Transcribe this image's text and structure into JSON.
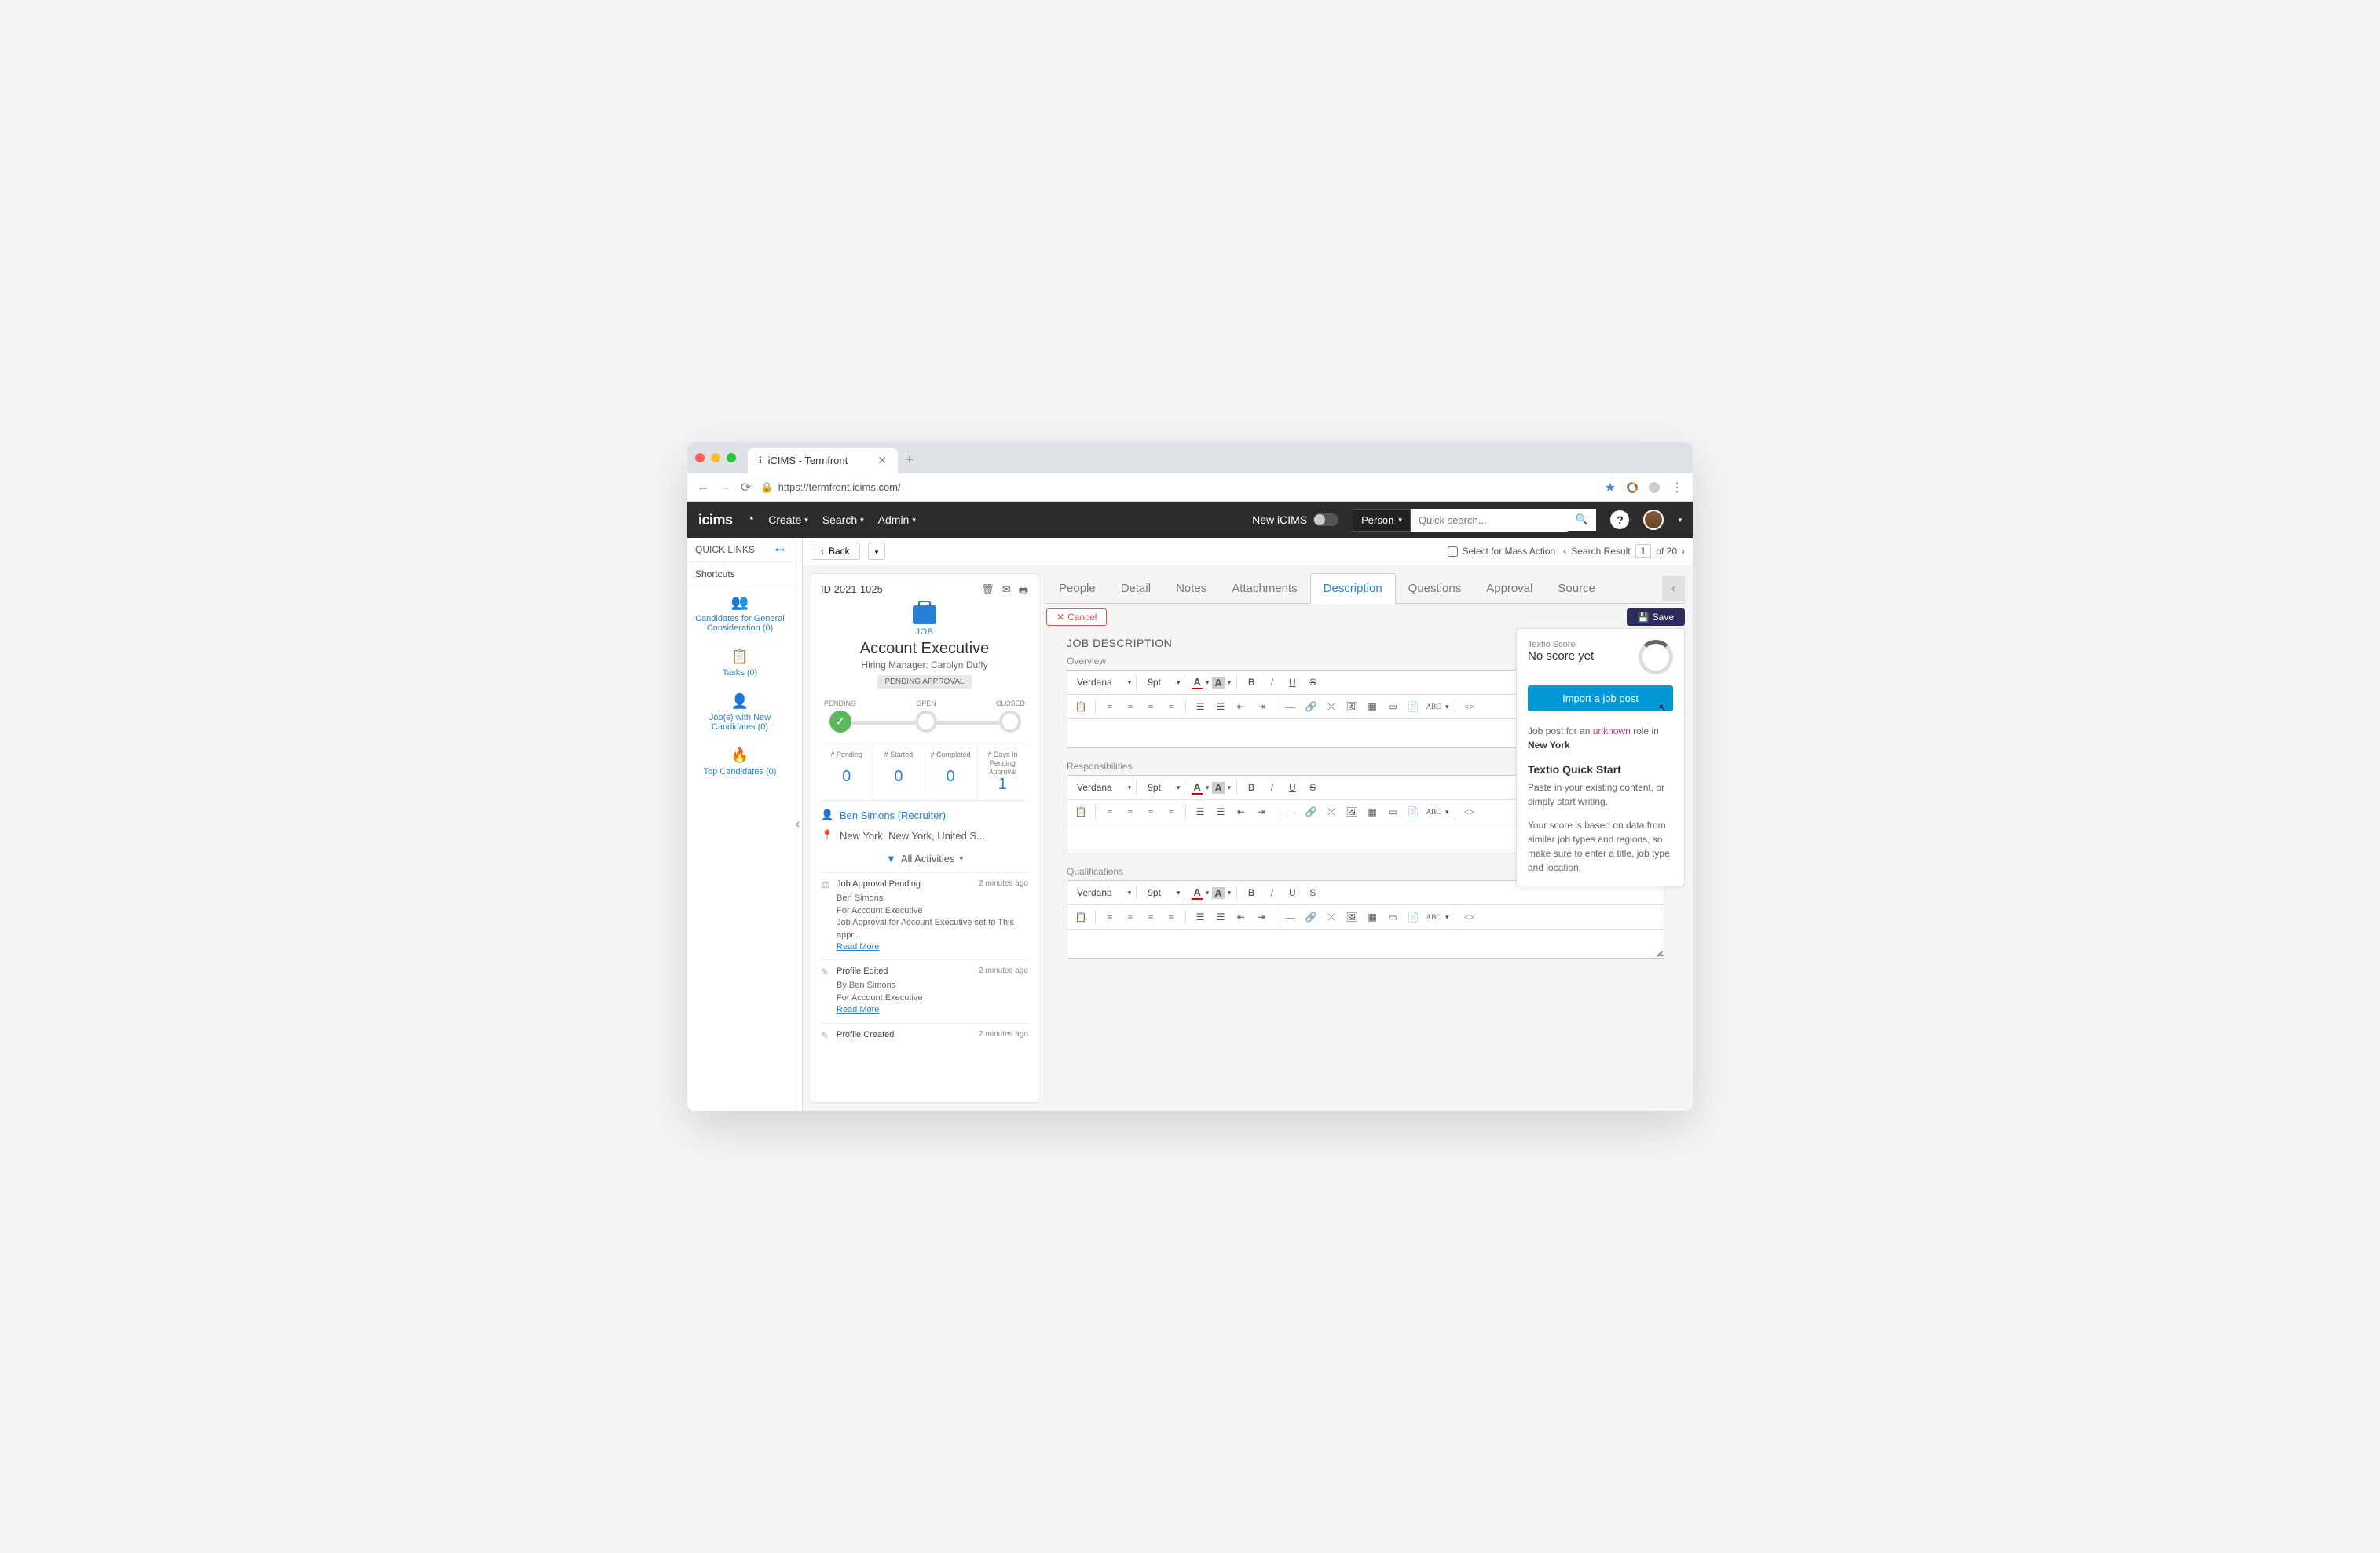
{
  "browser": {
    "tab_title": "iCIMS - Termfront",
    "url": "https://termfront.icims.com/"
  },
  "nav": {
    "logo": "icims",
    "items": [
      "Create",
      "Search",
      "Admin"
    ],
    "toggle_label": "New iCIMS",
    "person_label": "Person",
    "search_placeholder": "Quick search..."
  },
  "action_bar": {
    "back": "Back",
    "mass_action": "Select for Mass Action",
    "search_result_label": "Search Result",
    "search_result_current": "1",
    "search_result_total": "of 20"
  },
  "sidebar": {
    "header": "QUICK LINKS",
    "shortcuts": "Shortcuts",
    "items": [
      {
        "label": "Candidates for General Consideration (0)",
        "icon": "👥"
      },
      {
        "label": "Tasks (0)",
        "icon": "📋"
      },
      {
        "label": "Job(s) with New Candidates (0)",
        "icon": "👤"
      },
      {
        "label": "Top Candidates (0)",
        "icon": "🔥"
      }
    ]
  },
  "job": {
    "id": "ID 2021-1025",
    "type": "JOB",
    "title": "Account Executive",
    "manager": "Hiring Manager: Carolyn Duffy",
    "status": "PENDING APPROVAL",
    "progress": [
      "PENDING",
      "OPEN",
      "CLOSED"
    ],
    "stats": [
      {
        "label": "# Pending",
        "value": "0"
      },
      {
        "label": "# Started",
        "value": "0"
      },
      {
        "label": "# Completed",
        "value": "0"
      },
      {
        "label": "# Days In Pending Approval",
        "value": "1"
      }
    ],
    "recruiter": "Ben Simons (Recruiter)",
    "location": "New York, New York, United S...",
    "activities_header": "All Activities",
    "activities": [
      {
        "title": "Job Approval Pending",
        "time": "2 minutes ago",
        "lines": [
          "Ben Simons",
          "For Account Executive",
          "Job Approval for Account Executive set to This appr..."
        ],
        "read_more": "Read More",
        "icon": "⚖"
      },
      {
        "title": "Profile Edited",
        "time": "2 minutes ago",
        "lines": [
          "By Ben Simons",
          "For Account Executive"
        ],
        "read_more": "Read More",
        "icon": "✎"
      },
      {
        "title": "Profile Created",
        "time": "2 minutes ago",
        "lines": [],
        "read_more": "",
        "icon": "✎"
      }
    ]
  },
  "tabs": [
    "People",
    "Detail",
    "Notes",
    "Attachments",
    "Description",
    "Questions",
    "Approval",
    "Source"
  ],
  "active_tab": "Description",
  "buttons": {
    "cancel": "Cancel",
    "save": "Save"
  },
  "editor": {
    "section_title": "JOB DESCRIPTION",
    "fields": [
      "Overview",
      "Responsibilities",
      "Qualifications"
    ],
    "font": "Verdana",
    "size": "9pt"
  },
  "textio": {
    "score_label": "Textio Score",
    "score_value": "No score yet",
    "import": "Import a job post",
    "line1_pre": "Job post for an ",
    "line1_unknown": "unknown",
    "line1_mid": " role in ",
    "line1_loc": "New York",
    "quick_start": "Textio Quick Start",
    "quick_body": "Paste in your existing content, or simply start writing.",
    "footer": "Your score is based on data from similar job types and regions, so make sure to enter a title, job type, and location."
  }
}
